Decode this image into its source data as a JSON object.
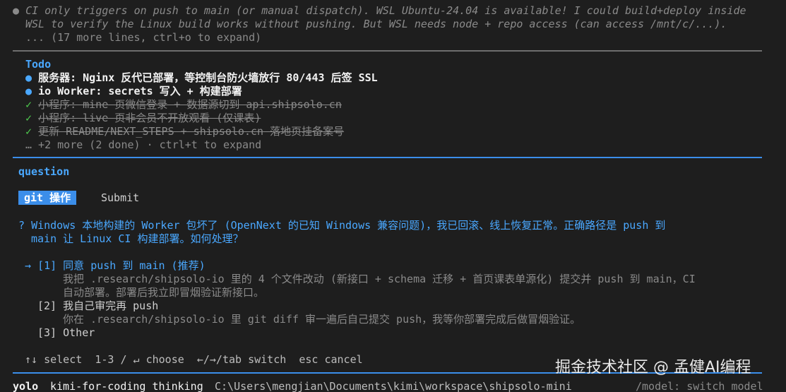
{
  "log": {
    "line1_bullet": "●",
    "line1": "CI only triggers on push to main (or manual dispatch). WSL Ubuntu-24.04 is available! I could build+deploy inside",
    "line2": "WSL to verify the Linux build works without pushing. But WSL needs node + repo access (can access /mnt/c/...).",
    "more": "... (17 more lines, ctrl+o to expand)"
  },
  "todo": {
    "title": "Todo",
    "items": [
      {
        "mark": "●",
        "text": "服务器: Nginx 反代已部署，等控制台防火墙放行 80/443 后签 SSL",
        "done": false
      },
      {
        "mark": "●",
        "text": "io Worker: secrets 写入 + 构建部署",
        "done": false
      },
      {
        "mark": "✓",
        "text": "小程序: mine 页微信登录 + 数据源切到 api.shipsolo.cn",
        "done": true
      },
      {
        "mark": "✓",
        "text": "小程序: live 页非会员不开放观看 (仅课表)",
        "done": true
      },
      {
        "mark": "✓",
        "text": "更新 README/NEXT_STEPS + shipsolo.cn 落地页挂备案号",
        "done": true
      }
    ],
    "more": "… +2 more (2 done) · ctrl+t to expand"
  },
  "question": {
    "header": "question",
    "tabs": [
      "git 操作",
      "Submit"
    ],
    "prompt_mark": "?",
    "prompt_line1": "Windows 本地构建的 Worker 包坏了 (OpenNext 的已知 Windows 兼容问题)，我已回滚、线上恢复正常。正确路径是 push 到",
    "prompt_line2": "main 让 Linux CI 构建部署。如何处理？",
    "options": [
      {
        "pointer": "→",
        "label": "[1] 同意 push 到 main (推荐)",
        "desc": [
          "我把 .research/shipsolo-io 里的 4 个文件改动 (新接口 + schema 迁移 + 首页课表单源化) 提交并 push 到 main，CI",
          "自动部署。部署后我立即冒烟验证新接口。"
        ]
      },
      {
        "pointer": "",
        "label": "[2] 我自己审完再 push",
        "desc": [
          "你在 .research/shipsolo-io 里 git diff 审一遍后自己提交 push，我等你部署完成后做冒烟验证。"
        ]
      },
      {
        "pointer": "",
        "label": "[3] Other",
        "desc": []
      }
    ],
    "hint": "↑↓ select  1-3 / ↵ choose  ←/→/tab switch  esc cancel"
  },
  "status_bar": {
    "mode": "yolo",
    "model": "kimi-for-coding thinking",
    "path": "C:\\Users\\mengjian\\Documents\\kimi\\workspace\\shipsolo-mini",
    "hint": "/model: switch model"
  },
  "watermark": "掘金技术社区 @ 孟健AI编程",
  "colors": {
    "background": "#1e1e1e",
    "accent_blue": "#4aa8ff",
    "tab_active_bg": "#3b8eea",
    "done_green": "#4ec94e",
    "dim": "#8a8a8a"
  }
}
